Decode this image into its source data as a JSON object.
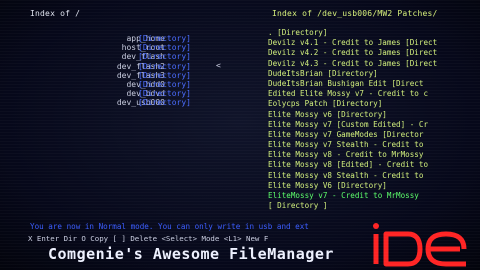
{
  "left_pane": {
    "title": "Index of /",
    "entries": [
      {
        "name": "app_home",
        "tag": "[Directory]"
      },
      {
        "name": "host_root",
        "tag": "[Directory]"
      },
      {
        "name": "dev_flash",
        "tag": "[Directory]"
      },
      {
        "name": "dev_flash2",
        "tag": "[Directory]"
      },
      {
        "name": "dev_flash3",
        "tag": "[Directory]"
      },
      {
        "name": "dev_hdd0",
        "tag": "[Directory]"
      },
      {
        "name": "dev_bdvd",
        "tag": "[Directory]"
      },
      {
        "name": "dev_usb000",
        "tag": "[Directory]"
      }
    ],
    "cursor": "<"
  },
  "right_pane": {
    "title": "Index of /dev_usb006/MW2 Patches/",
    "entries": [
      ". [Directory]",
      "Devilz v4.1 - Credit to James [Direct",
      "Devilz v4.2 - Credit to James [Direct",
      "Devilz v4.3 - Credit to James [Direct",
      "DudeItsBrian [Directory]",
      "DudeItsBrian Bushigan Edit [Direct",
      "Edited Elite Mossy v7 - Credit to c",
      "Eolycps Patch [Directory]",
      "Elite Mossy v6 [Directory]",
      "Elite Mossy v7 [Custom Edited] - Cr",
      "Elite Mossy v7 GameModes [Director",
      "Elite Mossy v7 Stealth - Credit to",
      "Elite Mossy v8 - Credit to MrMossy",
      "Elite Mossy v8 [Edited] - Credit to",
      "Elite Mossy v8 Stealth - Credit to",
      "Elite Mossy V6 [Directory]",
      "EliteMossy v7 - Credit to MrMossy",
      "[ Directory ]"
    ],
    "selected_index": 16
  },
  "status_line": "You are now in Normal mode. You can only write in usb and ext",
  "help_line": "X Enter Dir  O Copy  [ ] Delete <Select> Mode <L1> New F",
  "footer_title": "Comgenie's Awesome FileManager",
  "logo": {
    "text": "iDE",
    "color": "#ff2424"
  }
}
